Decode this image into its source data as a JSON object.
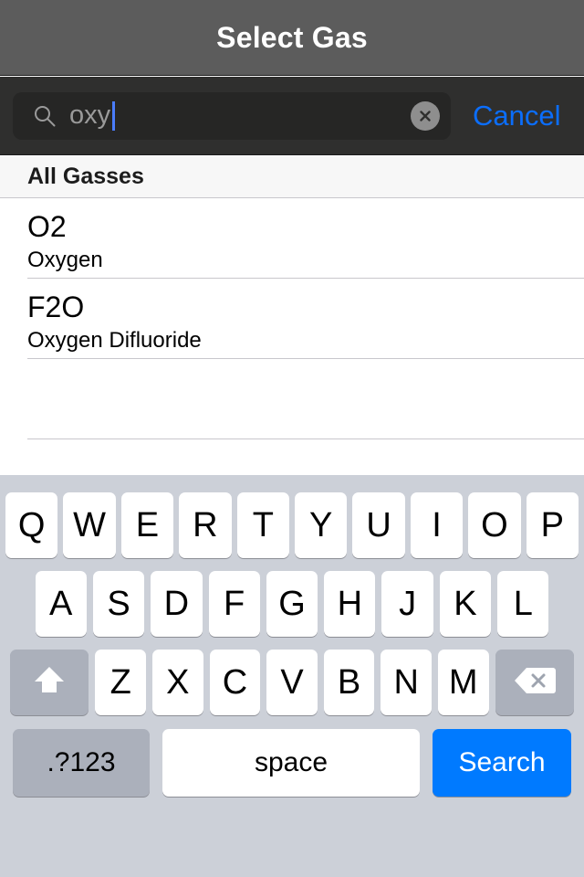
{
  "navbar": {
    "title": "Select Gas"
  },
  "search": {
    "icon": "search-icon",
    "value": "oxy",
    "placeholder": "Search",
    "clear_icon": "clear-circle-x-icon",
    "cancel_label": "Cancel",
    "caret_color": "#4a7dfd"
  },
  "list": {
    "section_header": "All Gasses",
    "rows": [
      {
        "title": "O2",
        "subtitle": "Oxygen"
      },
      {
        "title": "F2O",
        "subtitle": "Oxygen Difluoride"
      }
    ],
    "empty_rows": 1
  },
  "keyboard": {
    "row1": [
      "Q",
      "W",
      "E",
      "R",
      "T",
      "Y",
      "U",
      "I",
      "O",
      "P"
    ],
    "row2": [
      "A",
      "S",
      "D",
      "F",
      "G",
      "H",
      "J",
      "K",
      "L"
    ],
    "row3": [
      "Z",
      "X",
      "C",
      "V",
      "B",
      "N",
      "M"
    ],
    "shift_icon": "shift-arrow-up-icon",
    "backspace_icon": "backspace-delete-icon",
    "numeric_label": ".?123",
    "space_label": "space",
    "search_label": "Search"
  },
  "colors": {
    "navbar_bg": "#5c5c5c",
    "searchbar_bg": "#2f2f2e",
    "search_field_bg": "#262625",
    "accent_blue": "#007aff",
    "cancel_blue": "#0b6efd",
    "keyboard_bg": "#ccd0d8",
    "key_bg": "#ffffff",
    "key_fn_bg": "#abb0bb",
    "separator": "#c8c7cc",
    "section_header_bg": "#f7f7f7"
  }
}
